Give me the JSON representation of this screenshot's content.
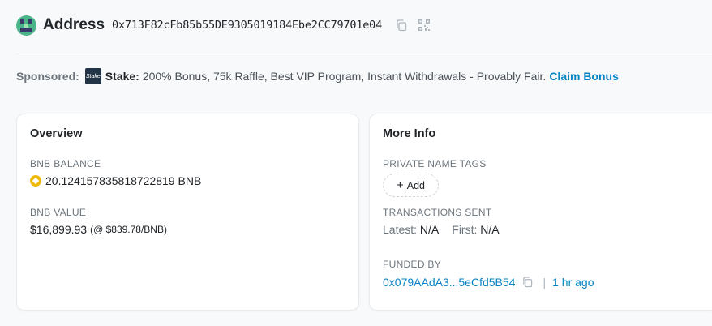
{
  "header": {
    "title": "Address",
    "address": "0x713F82cFb85b55DE9305019184Ebe2CC79701e04"
  },
  "sponsor": {
    "label": "Sponsored:",
    "logo_text": "Stake",
    "brand": "Stake:",
    "description": "200% Bonus, 75k Raffle, Best VIP Program, Instant Withdrawals - Provably Fair.",
    "cta": "Claim Bonus"
  },
  "overview": {
    "title": "Overview",
    "balance_label": "BNB BALANCE",
    "balance_value": "20.124157835818722819 BNB",
    "value_label": "BNB VALUE",
    "value_amount": "$16,899.93",
    "value_rate": "(@ $839.78/BNB)"
  },
  "more_info": {
    "title": "More Info",
    "tags_label": "PRIVATE NAME TAGS",
    "add_label": "Add",
    "tx_label": "TRANSACTIONS SENT",
    "latest_label": "Latest:",
    "latest_value": "N/A",
    "first_label": "First:",
    "first_value": "N/A",
    "funded_label": "FUNDED BY",
    "funded_address": "0x079AAdA3...5eCfd5B54",
    "funded_time": "1 hr ago"
  },
  "icons": {
    "copy": "copy-icon",
    "qr": "qr-code-icon",
    "bnb": "bnb-coin-icon",
    "avatar": "address-avatar"
  },
  "colors": {
    "link": "#0784c3",
    "bnb": "#f0b90b",
    "background": "#f8f9fa"
  }
}
